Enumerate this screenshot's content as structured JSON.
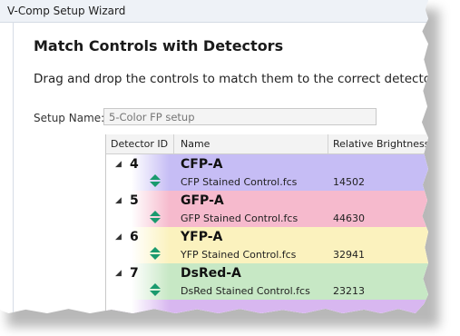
{
  "window": {
    "title": "V-Comp Setup Wizard"
  },
  "page": {
    "heading": "Match Controls with Detectors",
    "instructions": "Drag and drop the controls to match them to the correct detector."
  },
  "setup": {
    "label": "Setup Name:",
    "placeholder": "5-Color FP setup"
  },
  "grid": {
    "columns": [
      "Detector ID",
      "Name",
      "Relative Brightness"
    ],
    "groups": [
      {
        "id": "4",
        "detector": "CFP-A",
        "control": "CFP Stained Control.fcs",
        "brightness": "14502",
        "color": "#c6bdf5"
      },
      {
        "id": "5",
        "detector": "GFP-A",
        "control": "GFP Stained Control.fcs",
        "brightness": "44630",
        "color": "#f6bacd"
      },
      {
        "id": "6",
        "detector": "YFP-A",
        "control": "YFP Stained Control.fcs",
        "brightness": "32941",
        "color": "#fbf2be"
      },
      {
        "id": "7",
        "detector": "DsRed-A",
        "control": "DsRed Stained Control.fcs",
        "brightness": "23213",
        "color": "#c7e8c5"
      }
    ]
  },
  "icons": {
    "expander": "collapse-triangle-icon",
    "handle": "drag-handle-icon"
  },
  "colors": {
    "handle": "#1a9a6e",
    "partial_row": "#d8b7f0"
  }
}
